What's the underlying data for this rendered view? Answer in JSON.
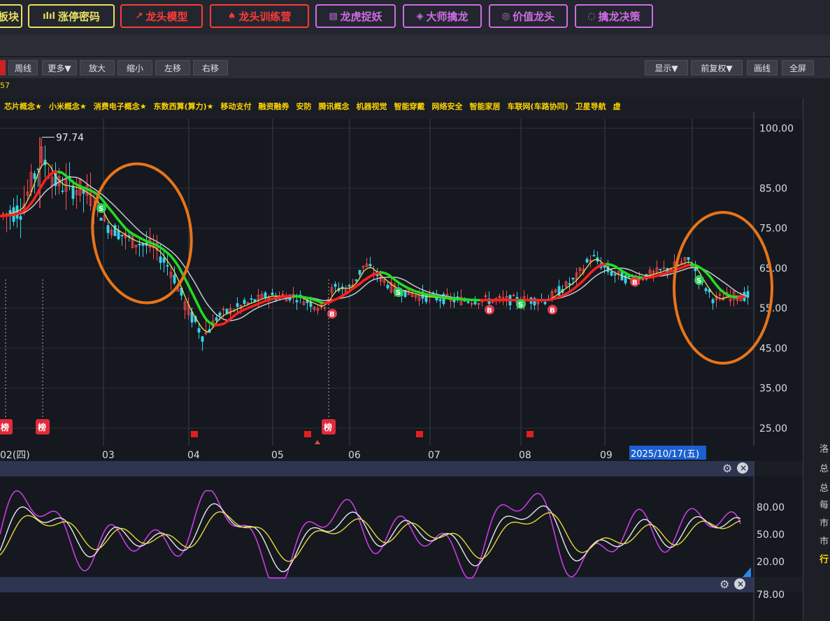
{
  "top_buttons": [
    {
      "label": "板块",
      "color": "#e8e060",
      "icon": "block-icon"
    },
    {
      "label": "涨停密码",
      "color": "#e8e060",
      "icon": "bars-icon"
    },
    {
      "label": "龙头模型",
      "color": "#ff3b3b",
      "icon": "trend-icon"
    },
    {
      "label": "龙头训练营",
      "color": "#ff3b3b",
      "icon": "dragon-icon"
    },
    {
      "label": "龙虎捉妖",
      "color": "#cf6ce6",
      "icon": "book-icon"
    },
    {
      "label": "大师擒龙",
      "color": "#cf6ce6",
      "icon": "cube-icon"
    },
    {
      "label": "价值龙头",
      "color": "#cf6ce6",
      "icon": "circle-icon"
    },
    {
      "label": "擒龙决策",
      "color": "#cf6ce6",
      "icon": "wave-icon"
    }
  ],
  "toolbar": {
    "left": [
      "周线",
      "更多▼",
      "放大",
      "缩小",
      "左移",
      "右移"
    ],
    "right": [
      "显示▼",
      "前复权▼",
      "画线",
      "全屏"
    ]
  },
  "code_fragment": "57",
  "concept_tags": [
    "芯片概念★",
    "小米概念★",
    "消费电子概念★",
    "东数西算(算力)★",
    "移动支付",
    "融资融券",
    "安防",
    "腾讯概念",
    "机器视觉",
    "智能穿戴",
    "网络安全",
    "智能家居",
    "车联网(车路协同)",
    "卫星导航",
    "虚"
  ],
  "chart_data": {
    "type": "candlestick",
    "price_axis": [
      "100.00",
      "85.00",
      "75.00",
      "65.00",
      "55.00",
      "45.00",
      "35.00",
      "25.00"
    ],
    "price_ticks": [
      100,
      85,
      75,
      65,
      55,
      45,
      35,
      25
    ],
    "ylim": [
      22,
      102
    ],
    "peak_label": "97.74",
    "peak_value": 97.74,
    "x_labels": [
      "02(四)",
      "03",
      "04",
      "05",
      "06",
      "07",
      "08",
      "09"
    ],
    "current_date": "2025/10/17(五)",
    "signal_markers": [
      "B",
      "B",
      "B",
      "B",
      "S",
      "S",
      "S",
      "S"
    ],
    "event_markers": [
      "榜",
      "榜",
      "榜"
    ],
    "ma_series": [
      {
        "color": "#ff2020"
      },
      {
        "color": "#22dd22"
      },
      {
        "color": "#e8e050"
      },
      {
        "color": "#c8c8d0"
      }
    ],
    "indicator": {
      "axis": [
        "80.00",
        "50.00",
        "20.00"
      ],
      "ticks": [
        80,
        50,
        20
      ],
      "ylim": [
        0,
        100
      ],
      "series": [
        {
          "color": "#c93ae6"
        },
        {
          "color": "#e8e8ee"
        },
        {
          "color": "#e6d83a"
        }
      ]
    },
    "third_panel_axis": "78.00"
  },
  "right_panel_chars": [
    "洛",
    "总",
    "总",
    "每",
    "市",
    "市",
    "行"
  ],
  "annotation_color": "#e8741a"
}
